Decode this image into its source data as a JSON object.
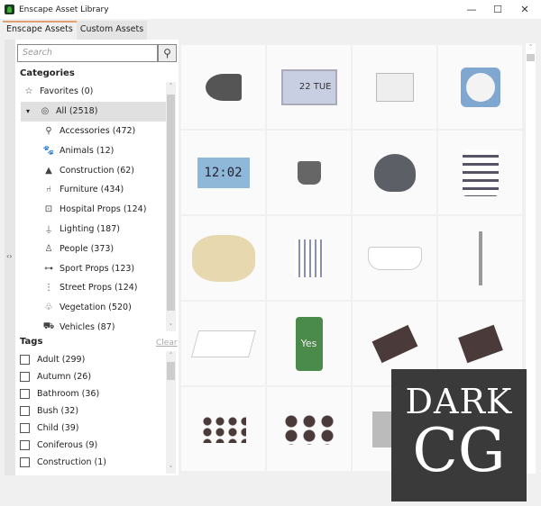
{
  "window": {
    "title": "Enscape Asset Library",
    "minimize": "—",
    "maximize": "☐",
    "close": "✕"
  },
  "tabs": [
    {
      "label": "Enscape Assets",
      "active": true
    },
    {
      "label": "Custom Assets",
      "active": false
    }
  ],
  "search": {
    "placeholder": "Search",
    "icon": "search-icon"
  },
  "categories": {
    "heading": "Categories",
    "items": [
      {
        "label": "Favorites (0)",
        "icon": "star-icon",
        "glyph": "☆",
        "indent": 0
      },
      {
        "label": "All (2518)",
        "icon": "all-icon",
        "glyph": "◎",
        "indent": 0,
        "selected": true,
        "expander": "▾"
      },
      {
        "label": "Accessories (472)",
        "icon": "accessories-icon",
        "glyph": "⚲",
        "indent": 1
      },
      {
        "label": "Animals (12)",
        "icon": "animals-icon",
        "glyph": "🐾",
        "indent": 1
      },
      {
        "label": "Construction (62)",
        "icon": "construction-icon",
        "glyph": "▲",
        "indent": 1
      },
      {
        "label": "Furniture (434)",
        "icon": "furniture-icon",
        "glyph": "⑁",
        "indent": 1
      },
      {
        "label": "Hospital Props (124)",
        "icon": "hospital-icon",
        "glyph": "⊡",
        "indent": 1
      },
      {
        "label": "Lighting (187)",
        "icon": "lighting-icon",
        "glyph": "⍊",
        "indent": 1
      },
      {
        "label": "People (373)",
        "icon": "person-icon",
        "glyph": "♙",
        "indent": 1
      },
      {
        "label": "Sport Props (123)",
        "icon": "dumbbell-icon",
        "glyph": "⊶",
        "indent": 1
      },
      {
        "label": "Street Props (124)",
        "icon": "street-icon",
        "glyph": "⋮",
        "indent": 1
      },
      {
        "label": "Vegetation (520)",
        "icon": "tree-icon",
        "glyph": "♧",
        "indent": 1
      },
      {
        "label": "Vehicles (87)",
        "icon": "vehicle-icon",
        "glyph": "⛟",
        "indent": 1
      }
    ]
  },
  "tags": {
    "heading": "Tags",
    "clear_label": "Clear",
    "items": [
      "Adult (299)",
      "Autumn (26)",
      "Bathroom (36)",
      "Bush (32)",
      "Child (39)",
      "Coniferous (9)",
      "Construction (1)"
    ]
  },
  "assets": [
    {
      "name": "tape-dispenser",
      "text": ""
    },
    {
      "name": "alarm-clock-calendar",
      "text": "22 TUE"
    },
    {
      "name": "white-clock",
      "text": ""
    },
    {
      "name": "blue-clock",
      "text": ""
    },
    {
      "name": "digital-clock",
      "text": "12:02"
    },
    {
      "name": "metal-cup",
      "text": ""
    },
    {
      "name": "teapot",
      "text": ""
    },
    {
      "name": "patterned-mug",
      "text": ""
    },
    {
      "name": "woven-basket",
      "text": ""
    },
    {
      "name": "folded-towel",
      "text": ""
    },
    {
      "name": "bathtub",
      "text": ""
    },
    {
      "name": "floor-faucet",
      "text": ""
    },
    {
      "name": "sink",
      "text": ""
    },
    {
      "name": "soda-can",
      "text": "Yes"
    },
    {
      "name": "binder-clip",
      "text": ""
    },
    {
      "name": "binder-clip-large",
      "text": ""
    },
    {
      "name": "binder-clips-pile",
      "text": ""
    },
    {
      "name": "binder-clips-group",
      "text": ""
    },
    {
      "name": "sponge",
      "text": ""
    },
    {
      "name": "asset",
      "text": ""
    }
  ],
  "watermark": {
    "line1": "DARK",
    "line2": "CG"
  }
}
